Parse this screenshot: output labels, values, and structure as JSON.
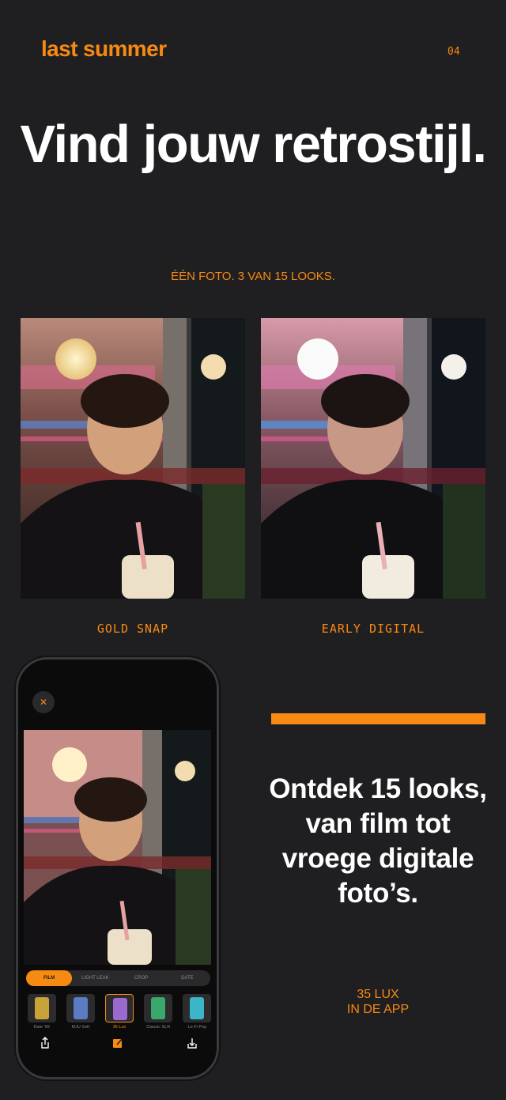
{
  "header": {
    "brand": "last summer",
    "page_number": "04"
  },
  "hero": {
    "title": "Vind jouw retrostijl.",
    "subtitle": "ÉÉN FOTO. 3 VAN 15 LOOKS."
  },
  "looks": [
    {
      "caption": "GOLD SNAP"
    },
    {
      "caption": "EARLY DIGITAL"
    }
  ],
  "phone": {
    "close_icon": "close-icon",
    "tabs": [
      {
        "label": "FILM",
        "active": true
      },
      {
        "label": "LIGHT LEAK",
        "active": false
      },
      {
        "label": "CROP",
        "active": false
      },
      {
        "label": "DATE",
        "active": false
      }
    ],
    "films": [
      {
        "label": "Date '99",
        "color": "#c9a23a"
      },
      {
        "label": "MJU Soft",
        "color": "#5a7cc4"
      },
      {
        "label": "35 Lux",
        "color": "#9b6ad0",
        "selected": true
      },
      {
        "label": "Classic SLR",
        "color": "#3aa86a"
      },
      {
        "label": "Lo-Fi Pop",
        "color": "#3ab6c8"
      }
    ],
    "toolbar_icons": [
      "share-icon",
      "edit-icon",
      "download-icon"
    ]
  },
  "promo": {
    "text": "Ontdek 15 looks, van film tot vroege digitale foto’s.",
    "cta_line1": "35 LUX",
    "cta_line2": "IN DE APP"
  },
  "colors": {
    "background": "#1f1f22",
    "accent": "#f78a12"
  }
}
